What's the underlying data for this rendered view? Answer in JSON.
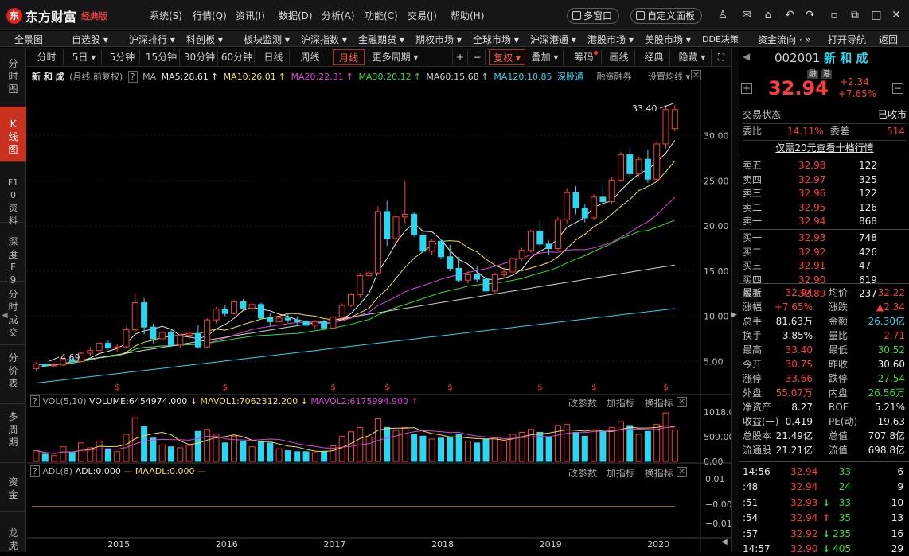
{
  "app": {
    "name": "东方财富",
    "edition": "经典版"
  },
  "main_menu": [
    "系统(S)",
    "行情(Q)",
    "资讯(I)",
    "数据(D)",
    "分析(A)",
    "功能(C)",
    "交易(J)",
    "帮助(H)"
  ],
  "title_buttons": {
    "multiwin": "多窗口",
    "custom_panel": "自定义面板"
  },
  "nav": [
    "全景图",
    "自选股 ▾",
    "沪深排行 ▾",
    "科创板 ▾",
    "板块监测 ▾",
    "沪深指数 ▾",
    "金融期货 ▾",
    "期权市场 ▾",
    "全球市场 ▾",
    "沪深港通 ▾",
    "港股市场 ▾",
    "美股市场 ▾",
    "DDE决策",
    "资金流向 · »",
    "打开导航",
    "返回"
  ],
  "left_tabs": [
    "分时图",
    "K线图",
    "F10资料",
    "深度F9",
    "分时成交",
    "分价表",
    "多周期",
    "资金",
    "龙虎"
  ],
  "toolbar": {
    "periods": [
      "分时",
      "5日 ▾",
      "5分钟",
      "15分钟",
      "30分钟",
      "60分钟",
      "日线",
      "周线",
      "月线",
      "更多周期 ▾"
    ],
    "right": [
      "+",
      "−",
      "复权 ▾",
      "叠加 ▾",
      "筹码",
      "画线",
      "经典",
      "隐藏 ▾",
      "⛶"
    ]
  },
  "stock": {
    "code": "002001",
    "name": "新 和 成",
    "badge1": "融",
    "badge2": "港",
    "price": "32.94",
    "change": "+2.34",
    "change_pct": "+7.65%"
  },
  "legend": {
    "name": "新 和 成",
    "desc": "(月线,前复权)",
    "ma_label": "MA",
    "ma5": "MA5:28.61",
    "ma10": "MA10:26.01",
    "ma20": "MA20:22.31",
    "ma30": "MA30:20.12",
    "ma60": "MA60:15.68",
    "ma120": "MA120:10.85",
    "tags": [
      "深股通",
      "融资融券",
      "设置均线 ▾"
    ]
  },
  "vol_legend": {
    "title": "VOL(5,10)",
    "volume": "VOLUME:6454974.000",
    "mavol1": "MAVOL1:7062312.200",
    "mavol2": "MAVOL2:6175994.900",
    "btns": [
      "改参数",
      "加指标",
      "换指标"
    ]
  },
  "adl_legend": {
    "title": "ADL(8)",
    "adl": "ADL:0.000",
    "maadl": "MAADL:0.000",
    "btns": [
      "改参数",
      "加指标",
      "换指标"
    ]
  },
  "chart_data": {
    "type": "candlestick",
    "title": "新 和 成 (月线,前复权)",
    "y_ticks": [
      "30.00",
      "25.00",
      "20.00",
      "15.00",
      "10.00",
      "5.00"
    ],
    "y_range": [
      1.5,
      35
    ],
    "x_ticks": [
      "2015",
      "2016",
      "2017",
      "2018",
      "2019",
      "2020"
    ],
    "annotations": {
      "high": "33.40",
      "low": "4.69"
    },
    "vol_ticks": [
      "1018.00",
      "509.00",
      "0.00"
    ],
    "vol_max": 1018,
    "adl_ticks": [
      "0.01",
      "−0.00",
      "−0.01"
    ],
    "candles": [
      [
        4.2,
        4.9,
        4.0,
        4.7,
        220
      ],
      [
        4.7,
        4.8,
        4.4,
        4.5,
        150
      ],
      [
        4.5,
        4.8,
        4.4,
        4.6,
        120
      ],
      [
        4.6,
        5.3,
        4.5,
        5.2,
        300
      ],
      [
        5.2,
        5.4,
        4.9,
        5.0,
        180
      ],
      [
        5.0,
        6.1,
        4.9,
        5.9,
        380
      ],
      [
        5.9,
        6.6,
        5.6,
        6.2,
        280
      ],
      [
        6.2,
        7.2,
        5.9,
        7.0,
        420
      ],
      [
        7.0,
        7.3,
        6.3,
        6.5,
        260
      ],
      [
        6.5,
        6.9,
        6.0,
        6.6,
        200
      ],
      [
        6.6,
        8.8,
        6.5,
        8.5,
        560
      ],
      [
        8.5,
        12.5,
        8.2,
        11.5,
        900
      ],
      [
        11.5,
        12.0,
        8.0,
        8.8,
        720
      ],
      [
        8.8,
        9.2,
        7.0,
        7.5,
        480
      ],
      [
        7.5,
        8.5,
        7.3,
        8.2,
        340
      ],
      [
        8.2,
        8.6,
        6.6,
        6.8,
        300
      ],
      [
        6.8,
        8.0,
        6.5,
        7.9,
        280
      ],
      [
        7.9,
        8.6,
        7.4,
        8.1,
        330
      ],
      [
        8.1,
        9.0,
        6.4,
        6.6,
        620
      ],
      [
        6.6,
        9.8,
        6.5,
        9.6,
        660
      ],
      [
        9.6,
        11.0,
        9.2,
        10.8,
        560
      ],
      [
        10.8,
        11.2,
        10.0,
        10.3,
        380
      ],
      [
        10.3,
        11.8,
        10.2,
        11.6,
        520
      ],
      [
        11.6,
        11.9,
        10.6,
        10.9,
        420
      ],
      [
        10.9,
        11.6,
        10.5,
        11.3,
        300
      ],
      [
        11.3,
        11.5,
        9.7,
        9.8,
        420
      ],
      [
        9.8,
        10.3,
        8.9,
        9.4,
        380
      ],
      [
        9.4,
        10.0,
        9.0,
        9.8,
        260
      ],
      [
        9.8,
        10.4,
        9.3,
        9.6,
        220
      ],
      [
        9.6,
        10.0,
        9.1,
        9.4,
        200
      ],
      [
        9.4,
        9.8,
        8.7,
        9.0,
        200
      ],
      [
        9.0,
        9.6,
        8.6,
        9.4,
        180
      ],
      [
        9.4,
        9.6,
        8.5,
        8.7,
        210
      ],
      [
        8.7,
        10.0,
        8.6,
        9.9,
        320
      ],
      [
        9.9,
        11.4,
        9.7,
        11.2,
        520
      ],
      [
        11.2,
        12.6,
        11.0,
        12.4,
        610
      ],
      [
        12.4,
        14.8,
        12.0,
        14.5,
        700
      ],
      [
        14.5,
        15.0,
        14.0,
        14.8,
        500
      ],
      [
        14.8,
        22.2,
        14.6,
        21.6,
        880
      ],
      [
        21.6,
        22.8,
        17.8,
        18.6,
        700
      ],
      [
        18.6,
        21.5,
        18.0,
        21.0,
        640
      ],
      [
        21.0,
        25.0,
        20.3,
        21.3,
        700
      ],
      [
        21.3,
        21.6,
        18.8,
        19.0,
        560
      ],
      [
        19.0,
        19.6,
        17.0,
        17.2,
        520
      ],
      [
        17.2,
        18.6,
        16.8,
        18.3,
        460
      ],
      [
        18.3,
        18.6,
        16.3,
        16.6,
        480
      ],
      [
        16.6,
        17.9,
        15.0,
        15.3,
        500
      ],
      [
        15.3,
        16.6,
        13.8,
        14.0,
        560
      ],
      [
        14.0,
        15.0,
        13.6,
        14.6,
        420
      ],
      [
        14.6,
        15.6,
        13.8,
        14.1,
        380
      ],
      [
        14.1,
        14.4,
        12.6,
        12.8,
        460
      ],
      [
        12.8,
        14.8,
        12.5,
        14.6,
        500
      ],
      [
        14.6,
        15.4,
        14.2,
        14.9,
        420
      ],
      [
        14.9,
        16.6,
        14.7,
        16.4,
        560
      ],
      [
        16.4,
        17.6,
        16.1,
        17.3,
        600
      ],
      [
        17.3,
        19.6,
        17.0,
        19.4,
        660
      ],
      [
        19.4,
        20.6,
        17.6,
        18.0,
        600
      ],
      [
        18.0,
        18.4,
        16.8,
        17.5,
        500
      ],
      [
        17.5,
        21.0,
        17.3,
        20.7,
        740
      ],
      [
        20.7,
        24.2,
        20.3,
        23.7,
        760
      ],
      [
        23.7,
        24.4,
        21.3,
        22.0,
        600
      ],
      [
        22.0,
        22.5,
        20.4,
        20.9,
        520
      ],
      [
        20.9,
        23.5,
        20.7,
        23.2,
        640
      ],
      [
        23.2,
        24.6,
        22.3,
        22.7,
        620
      ],
      [
        22.7,
        25.4,
        22.4,
        25.1,
        700
      ],
      [
        25.1,
        28.2,
        24.9,
        27.9,
        820
      ],
      [
        27.9,
        28.6,
        25.3,
        25.8,
        740
      ],
      [
        25.8,
        27.6,
        25.5,
        27.4,
        560
      ],
      [
        27.4,
        28.5,
        24.8,
        25.2,
        620
      ],
      [
        25.2,
        29.5,
        25.0,
        29.1,
        760
      ],
      [
        29.1,
        33.4,
        28.6,
        32.9,
        1000
      ],
      [
        30.8,
        33.4,
        30.5,
        32.9,
        650
      ]
    ]
  },
  "panel": {
    "trade_status_label": "交易状态",
    "trade_status": "已收市",
    "weibi_label": "委比",
    "weibi": "14.11%",
    "weicha_label": "委差",
    "weicha": "514",
    "l2_link": "仅需20元查看十档行情",
    "asks": [
      [
        "卖五",
        "32.98",
        "122"
      ],
      [
        "卖四",
        "32.97",
        "325"
      ],
      [
        "卖三",
        "32.96",
        "122"
      ],
      [
        "卖二",
        "32.95",
        "126"
      ],
      [
        "卖一",
        "32.94",
        "868"
      ]
    ],
    "bids": [
      [
        "买一",
        "32.93",
        "748"
      ],
      [
        "买二",
        "32.92",
        "426"
      ],
      [
        "买三",
        "32.91",
        "47"
      ],
      [
        "买四",
        "32.90",
        "619"
      ],
      [
        "买五",
        "32.89",
        "237"
      ]
    ],
    "stats": [
      [
        "最新",
        "32.94",
        "red",
        "均价",
        "32.22",
        "red"
      ],
      [
        "涨幅",
        "+7.65%",
        "red",
        "涨跌",
        "▲2.34",
        "red"
      ],
      [
        "总手",
        "81.63万",
        "white",
        "金额",
        "26.30亿",
        "cyan"
      ],
      [
        "换手",
        "3.85%",
        "white",
        "量比",
        "2.71",
        "red"
      ],
      [
        "最高",
        "33.40",
        "red",
        "最低",
        "30.52",
        "green"
      ],
      [
        "今开",
        "30.75",
        "red",
        "昨收",
        "30.60",
        "white"
      ],
      [
        "涨停",
        "33.66",
        "red",
        "跌停",
        "27.54",
        "green"
      ],
      [
        "外盘",
        "55.07万",
        "red",
        "内盘",
        "26.56万",
        "green"
      ],
      [
        "净资产",
        "8.27",
        "white",
        "ROE",
        "5.21%",
        "white"
      ],
      [
        "收益(一)",
        "0.419",
        "white",
        "PE(动)",
        "19.63",
        "white"
      ],
      [
        "总股本",
        "21.49亿",
        "white",
        "总值",
        "707.8亿",
        "white"
      ],
      [
        "流通股",
        "21.21亿",
        "white",
        "流值",
        "698.8亿",
        "white"
      ]
    ],
    "ticks": [
      [
        "14:56",
        "32.94",
        "",
        "33",
        "6"
      ],
      [
        ":48",
        "32.94",
        "",
        "24",
        "9"
      ],
      [
        ":51",
        "32.93",
        "down",
        "33",
        "10"
      ],
      [
        ":54",
        "32.94",
        "up",
        "35",
        "13"
      ],
      [
        ":57",
        "32.92",
        "down",
        "235",
        "16"
      ],
      [
        "14:57",
        "32.90",
        "down",
        "405",
        "29"
      ]
    ]
  }
}
